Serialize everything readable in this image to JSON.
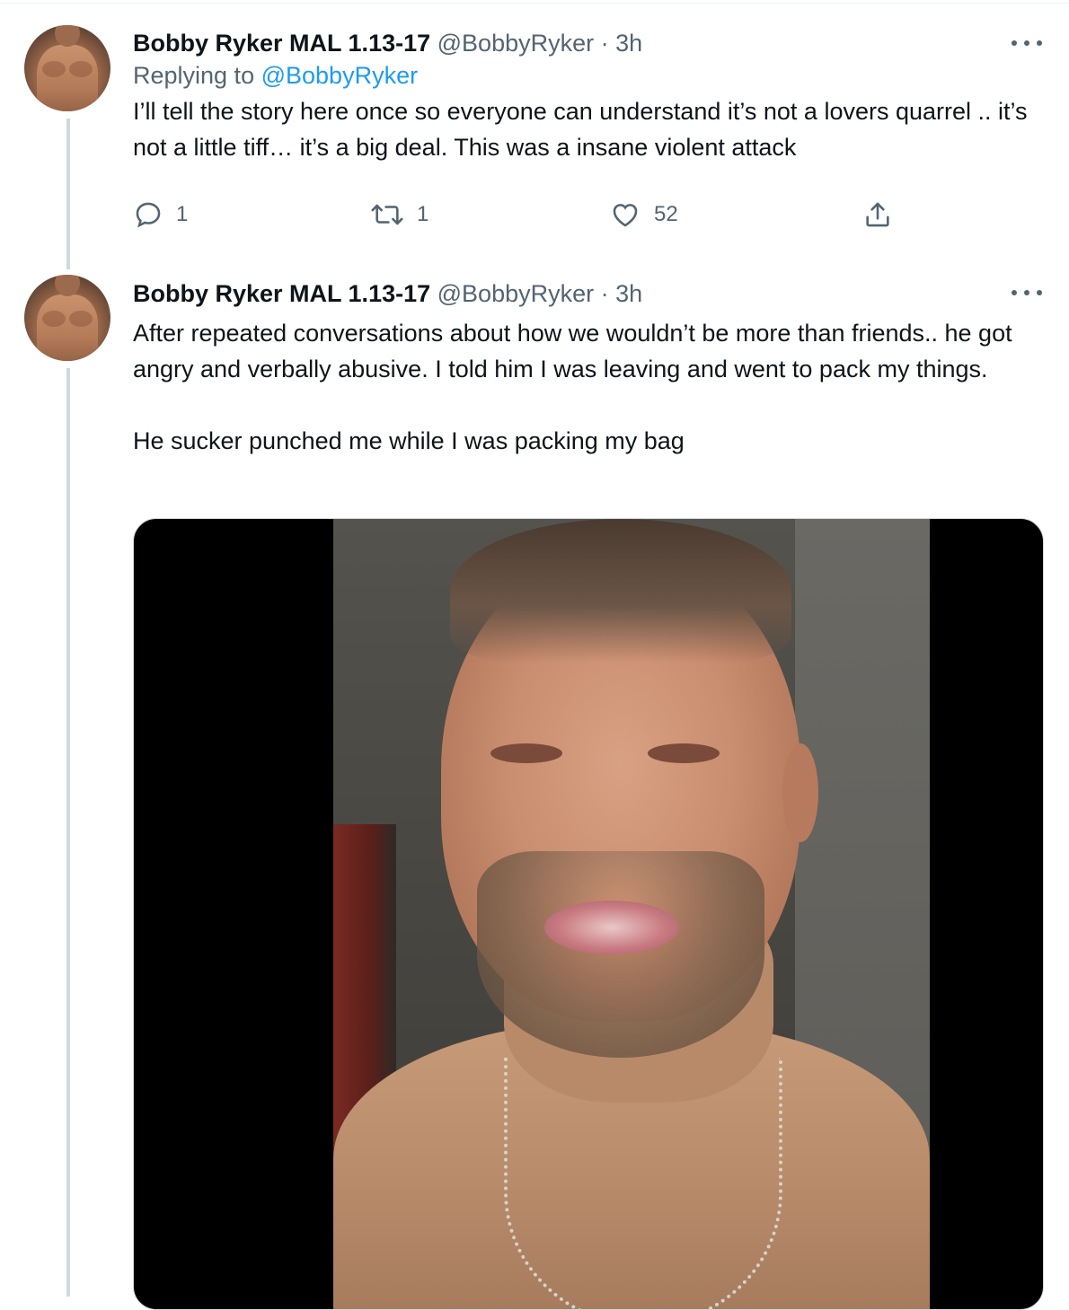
{
  "tweets": [
    {
      "display_name": "Bobby Ryker MAL 1.13-17",
      "handle": "@BobbyRyker",
      "separator": "·",
      "time": "3h",
      "replying_prefix": "Replying to",
      "replying_mention": "@BobbyRyker",
      "text": "I’ll tell the story here once so everyone can understand it’s not a lovers quarrel .. it’s not a little tiff… it’s a big deal. This was a insane violent attack",
      "actions": {
        "reply_count": "1",
        "retweet_count": "1",
        "like_count": "52"
      }
    },
    {
      "display_name": "Bobby Ryker MAL 1.13-17",
      "handle": "@BobbyRyker",
      "separator": "·",
      "time": "3h",
      "text": "After repeated conversations about how we wouldn’t be more than friends.. he got angry and verbally abusive. I told him I was leaving and went to pack my things.\n\nHe sucker punched me while I was packing my bag"
    }
  ],
  "icons": {
    "more": "more-horizontal-icon",
    "reply": "reply-bubble-icon",
    "retweet": "retweet-icon",
    "like": "heart-icon",
    "share": "share-upload-icon"
  },
  "colors": {
    "text_primary": "#0f1419",
    "text_secondary": "#536471",
    "link": "#1d9bf0",
    "thread_line": "#cfd9de"
  }
}
